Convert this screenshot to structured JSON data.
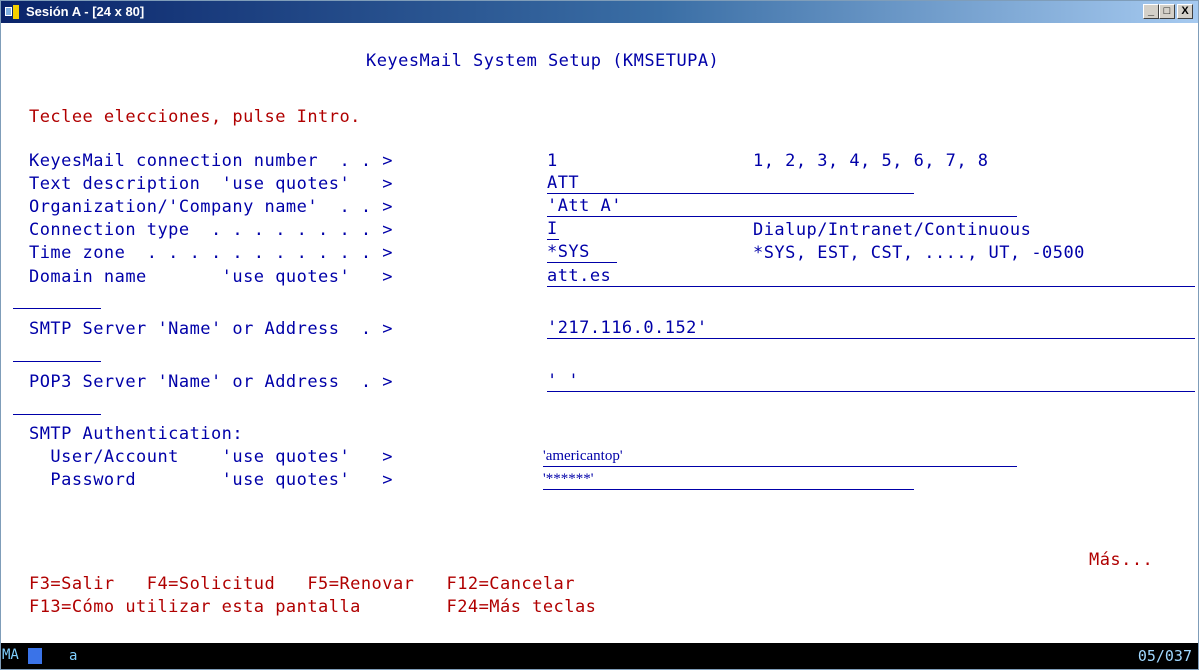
{
  "window": {
    "title": "Sesión A - [24 x 80]"
  },
  "controls": {
    "minimize": "_",
    "maximize": "□",
    "close": "X"
  },
  "screen": {
    "title": "KeyesMail System Setup (KMSETUPA)",
    "instruction": "Teclee elecciones, pulse Intro.",
    "fields": {
      "connection_number": {
        "label": "KeyesMail connection number  . . >",
        "value": "1",
        "hint": "1, 2, 3, 4, 5, 6, 7, 8"
      },
      "text_description": {
        "label": "Text description  'use quotes'   >",
        "value": "ATT"
      },
      "organization": {
        "label": "Organization/'Company name'  . . >",
        "value": "'Att A'"
      },
      "connection_type": {
        "label": "Connection type  . . . . . . . . >",
        "value": "I",
        "hint": "Dialup/Intranet/Continuous"
      },
      "time_zone": {
        "label": "Time zone  . . . . . . . . . . . >",
        "value": "*SYS",
        "hint": "*SYS, EST, CST, ...., UT, -0500"
      },
      "domain_name": {
        "label": "Domain name       'use quotes'   >",
        "value": "att.es"
      },
      "smtp_server": {
        "label": "SMTP Server 'Name' or Address  . >",
        "value": "'217.116.0.152'"
      },
      "pop3_server": {
        "label": "POP3 Server 'Name' or Address  . >",
        "value": "' '"
      },
      "smtp_auth_header": "SMTP Authentication:",
      "user_account": {
        "label": "  User/Account    'use quotes'   >",
        "value": "'americantop'"
      },
      "password": {
        "label": "  Password        'use quotes'   >",
        "value": "'******'"
      }
    },
    "more": "Más...",
    "fkeys_line1": "F3=Salir   F4=Solicitud   F5=Renovar   F12=Cancelar",
    "fkeys_line2": "F13=Cómo utilizar esta pantalla        F24=Más teclas"
  },
  "status_bar": {
    "mode": "MA",
    "input": "a",
    "cursor_position": "05/037"
  }
}
